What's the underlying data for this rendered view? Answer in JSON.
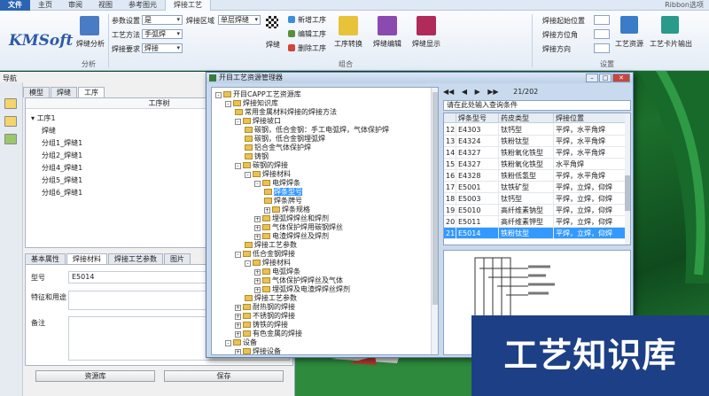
{
  "ribbon": {
    "tabs": [
      "文件",
      "主页",
      "审阅",
      "视图",
      "参考图元",
      "焊接工艺"
    ],
    "active_tab": "焊接工艺",
    "right_label": "Ribbon选项",
    "groups": {
      "analysis": "分析",
      "assembly": "组合",
      "settings": "设置"
    },
    "logo_text": "KMSoft",
    "weld_analysis": "焊缝分析",
    "param_labels": [
      "参数设置",
      "工艺方法",
      "焊接要求"
    ],
    "param_values": [
      "是",
      "手弧焊",
      "焊接"
    ],
    "weld_area_label": "焊接区域",
    "weld_area_value": "单层焊缝",
    "checkerboard_label": "焊缝",
    "weld_ops": [
      "新增工序",
      "编辑工序",
      "删除工序"
    ],
    "big_buttons": [
      "工序转换",
      "焊缝编辑",
      "焊缝显示"
    ],
    "right_fields": [
      "焊接起始位置",
      "焊接方位角",
      "焊接方向"
    ],
    "process_card": "工艺资源",
    "card_output": "工艺卡片输出"
  },
  "left": {
    "nav_title": "导航",
    "tabs": [
      "模型",
      "焊缝",
      "工序"
    ],
    "active_tab": "工序",
    "column_header": "工序树",
    "tree": [
      "工序1",
      "焊缝",
      "分组1_焊缝1",
      "分组2_焊缝1",
      "分组4_焊缝1",
      "分组5_焊缝1",
      "分组6_焊缝1"
    ],
    "prop_tabs": [
      "基本属性",
      "焊接材料",
      "焊接工艺参数",
      "图片"
    ],
    "prop_active": "焊接材料",
    "prop_labels": [
      "型号",
      "特征和用途",
      "备注"
    ],
    "prop_values": [
      "E5014",
      "",
      ""
    ],
    "btn_resource": "资源库",
    "btn_save": "保存"
  },
  "dialog": {
    "title": "开目工艺资源管理器",
    "tree": [
      {
        "t": "开目CAPP工艺资源库",
        "lvl": 0,
        "exp": "-"
      },
      {
        "t": "焊接知识库",
        "lvl": 1,
        "exp": "-"
      },
      {
        "t": "常用金属材料焊接的焊接方法",
        "lvl": 2,
        "exp": ""
      },
      {
        "t": "焊接坡口",
        "lvl": 2,
        "exp": "-"
      },
      {
        "t": "碳钢，低合金钢：手工电弧焊，气体保护焊",
        "lvl": 3,
        "exp": ""
      },
      {
        "t": "碳钢，低合金钢埋弧焊",
        "lvl": 3,
        "exp": ""
      },
      {
        "t": "铝合金气体保护焊",
        "lvl": 3,
        "exp": ""
      },
      {
        "t": "铸钢",
        "lvl": 3,
        "exp": ""
      },
      {
        "t": "碳钢的焊接",
        "lvl": 2,
        "exp": "-"
      },
      {
        "t": "焊接材料",
        "lvl": 3,
        "exp": "-"
      },
      {
        "t": "电焊焊条",
        "lvl": 4,
        "exp": "-"
      },
      {
        "t": "焊条型号",
        "lvl": 5,
        "exp": "",
        "sel": true
      },
      {
        "t": "焊条牌号",
        "lvl": 5,
        "exp": ""
      },
      {
        "t": "焊条规格",
        "lvl": 5,
        "exp": "+"
      },
      {
        "t": "埋弧焊焊丝和焊剂",
        "lvl": 4,
        "exp": "+"
      },
      {
        "t": "气体保护焊用碳钢焊丝",
        "lvl": 4,
        "exp": "+"
      },
      {
        "t": "电渣焊焊丝及焊剂",
        "lvl": 4,
        "exp": "+"
      },
      {
        "t": "焊接工艺参数",
        "lvl": 3,
        "exp": ""
      },
      {
        "t": "低合金钢焊接",
        "lvl": 2,
        "exp": "-"
      },
      {
        "t": "焊接材料",
        "lvl": 3,
        "exp": "-"
      },
      {
        "t": "电弧焊条",
        "lvl": 4,
        "exp": "+"
      },
      {
        "t": "气体保护焊焊丝及气体",
        "lvl": 4,
        "exp": "+"
      },
      {
        "t": "埋弧焊及电渣焊焊丝焊剂",
        "lvl": 4,
        "exp": "+"
      },
      {
        "t": "焊接工艺参数",
        "lvl": 3,
        "exp": ""
      },
      {
        "t": "耐热钢的焊接",
        "lvl": 2,
        "exp": "+"
      },
      {
        "t": "不锈钢的焊接",
        "lvl": 2,
        "exp": "+"
      },
      {
        "t": "铸铁的焊接",
        "lvl": 2,
        "exp": "+"
      },
      {
        "t": "有色金属的焊接",
        "lvl": 2,
        "exp": "+"
      },
      {
        "t": "设备",
        "lvl": 1,
        "exp": "-"
      },
      {
        "t": "焊接设备",
        "lvl": 2,
        "exp": "+"
      }
    ],
    "nav": {
      "buttons": [
        "◀◀",
        "◀",
        "▶",
        "▶▶"
      ],
      "record": "21/202"
    },
    "filter_placeholder": "请在此处输入查询条件",
    "grid_headers": [
      "",
      "焊条型号",
      "药皮类型",
      "焊接位置"
    ],
    "grid_rows": [
      [
        "12",
        "E4303",
        "钛钙型",
        "平焊，水平角焊"
      ],
      [
        "13",
        "E4324",
        "铁粉钛型",
        "平焊，水平角焊"
      ],
      [
        "14",
        "E4327",
        "铁粉氧化铁型",
        "平焊，水平角焊"
      ],
      [
        "15",
        "E4327",
        "铁粉氧化铁型",
        "水平角焊"
      ],
      [
        "16",
        "E4328",
        "铁粉低氢型",
        "平焊，水平角焊"
      ],
      [
        "17",
        "E5001",
        "钛铁矿型",
        "平焊，立焊，仰焊"
      ],
      [
        "18",
        "E5003",
        "钛钙型",
        "平焊，立焊，仰焊"
      ],
      [
        "19",
        "E5010",
        "高纤维素钠型",
        "平焊，立焊，仰焊"
      ],
      [
        "20",
        "E5011",
        "高纤维素钾型",
        "平焊，立焊，仰焊"
      ],
      [
        "21",
        "E5014",
        "铁粉钛型",
        "平焊，立焊，仰焊"
      ]
    ],
    "selected_row": 9
  },
  "banner": {
    "text": "工艺知识库"
  }
}
